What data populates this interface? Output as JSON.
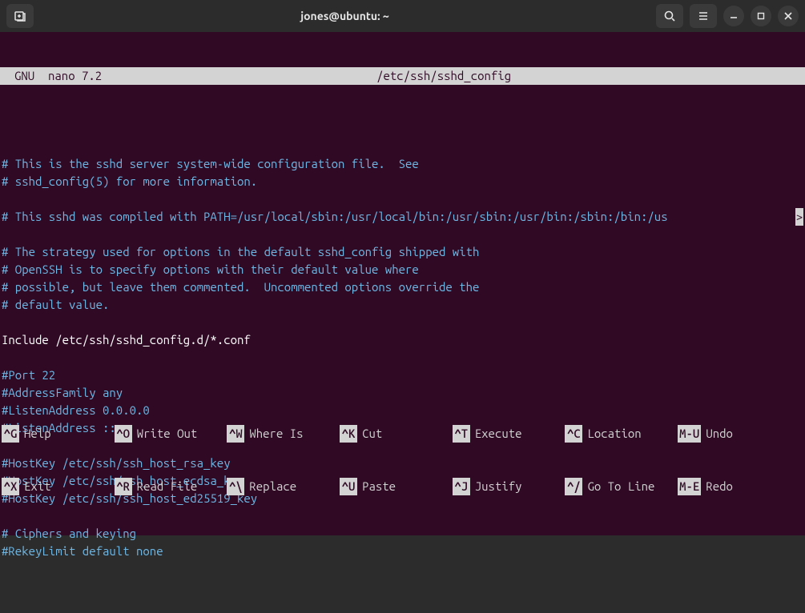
{
  "titlebar": {
    "title": "jones@ubuntu: ~"
  },
  "nano": {
    "app": "GNU  nano 7.2",
    "filename": "/etc/ssh/sshd_config"
  },
  "lines": [
    {
      "cls": "blank",
      "text": ""
    },
    {
      "cls": "comment",
      "text": "# This is the sshd server system-wide configuration file.  See"
    },
    {
      "cls": "comment",
      "text": "# sshd_config(5) for more information."
    },
    {
      "cls": "blank",
      "text": ""
    },
    {
      "cls": "comment",
      "text": "# This sshd was compiled with PATH=/usr/local/sbin:/usr/local/bin:/usr/sbin:/usr/bin:/sbin:/bin:/us",
      "overflow": ">"
    },
    {
      "cls": "blank",
      "text": ""
    },
    {
      "cls": "comment",
      "text": "# The strategy used for options in the default sshd_config shipped with"
    },
    {
      "cls": "comment",
      "text": "# OpenSSH is to specify options with their default value where"
    },
    {
      "cls": "comment",
      "text": "# possible, but leave them commented.  Uncommented options override the"
    },
    {
      "cls": "comment",
      "text": "# default value."
    },
    {
      "cls": "blank",
      "text": ""
    },
    {
      "cls": "normal",
      "text": "Include /etc/ssh/sshd_config.d/*.conf"
    },
    {
      "cls": "blank",
      "text": ""
    },
    {
      "cls": "comment",
      "text": "#Port 22"
    },
    {
      "cls": "comment",
      "text": "#AddressFamily any"
    },
    {
      "cls": "comment",
      "text": "#ListenAddress 0.0.0.0"
    },
    {
      "cls": "comment",
      "text": "#ListenAddress ::"
    },
    {
      "cls": "blank",
      "text": ""
    },
    {
      "cls": "comment",
      "text": "#HostKey /etc/ssh/ssh_host_rsa_key"
    },
    {
      "cls": "comment",
      "text": "#HostKey /etc/ssh/ssh_host_ecdsa_key"
    },
    {
      "cls": "comment",
      "text": "#HostKey /etc/ssh/ssh_host_ed25519_key"
    },
    {
      "cls": "blank",
      "text": ""
    },
    {
      "cls": "comment",
      "text": "# Ciphers and keying"
    },
    {
      "cls": "comment",
      "text": "#RekeyLimit default none"
    }
  ],
  "shortcuts_row1": [
    {
      "key": "^G",
      "label": "Help"
    },
    {
      "key": "^O",
      "label": "Write Out"
    },
    {
      "key": "^W",
      "label": "Where Is"
    },
    {
      "key": "^K",
      "label": "Cut"
    },
    {
      "key": "^T",
      "label": "Execute"
    },
    {
      "key": "^C",
      "label": "Location"
    },
    {
      "key": "M-U",
      "label": "Undo"
    }
  ],
  "shortcuts_row2": [
    {
      "key": "^X",
      "label": "Exit"
    },
    {
      "key": "^R",
      "label": "Read File"
    },
    {
      "key": "^\\",
      "label": "Replace"
    },
    {
      "key": "^U",
      "label": "Paste"
    },
    {
      "key": "^J",
      "label": "Justify"
    },
    {
      "key": "^/",
      "label": "Go To Line"
    },
    {
      "key": "M-E",
      "label": "Redo"
    }
  ]
}
